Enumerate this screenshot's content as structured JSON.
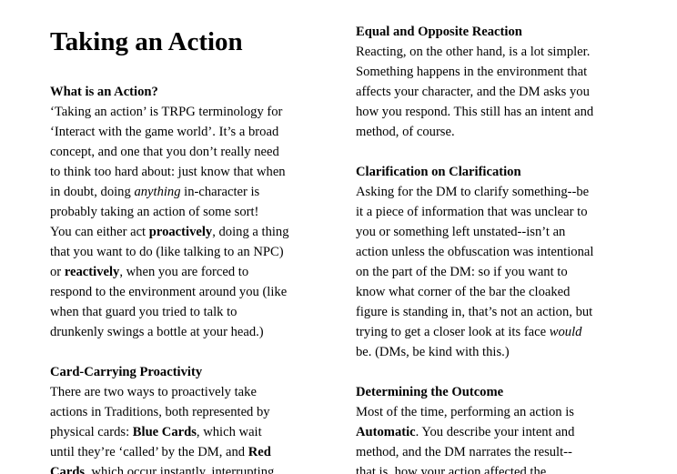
{
  "title": "Taking an Action",
  "left": {
    "s1_heading": "What is an Action?",
    "s1_l1": "‘Taking an action’ is TRPG terminology for",
    "s1_l2": "‘Interact with the game world’. It’s a broad",
    "s1_l3": "concept, and one that you don’t really need",
    "s1_l4": "to think too hard about: just know that when",
    "s1_l5a": "in doubt, doing ",
    "s1_l5b": "anything",
    "s1_l5c": " in-character is",
    "s1_l6": "probably taking an action of some sort!",
    "s1_l7a": "You can either act ",
    "s1_l7b": "proactively",
    "s1_l7c": ", doing a thing",
    "s1_l8": "that you want to do (like talking to an NPC)",
    "s1_l9a": "or ",
    "s1_l9b": "reactively",
    "s1_l9c": ", when you are forced to",
    "s1_l10": "respond to the environment around you (like",
    "s1_l11": "when that guard you tried to talk to",
    "s1_l12": "drunkenly swings a bottle at your head.)",
    "s2_heading": "Card-Carrying Proactivity",
    "s2_l1": "There are two ways to proactively take",
    "s2_l2": "actions in Traditions, both represented by",
    "s2_l3a": "physical cards: ",
    "s2_l3b": "Blue Cards",
    "s2_l3c": ", which wait",
    "s2_l4a": "until they’re ‘called’ by the DM, and ",
    "s2_l4b": "Red",
    "s2_l5a": "Cards",
    "s2_l5b": ", which occur instantly, interrupting"
  },
  "right": {
    "s1_heading": "Equal and Opposite Reaction",
    "s1_l1": "Reacting, on the other hand, is a lot simpler.",
    "s1_l2": "Something happens in the environment that",
    "s1_l3": "affects your character, and the DM asks you",
    "s1_l4": "how you respond. This still has an intent and",
    "s1_l5": "method, of course.",
    "s2_heading": "Clarification on Clarification",
    "s2_l1": "Asking for the DM to clarify something--be",
    "s2_l2": "it a piece of information that was unclear to",
    "s2_l3": "you or something left unstated--isn’t an",
    "s2_l4": "action unless the obfuscation was intentional",
    "s2_l5": "on the part of the DM: so if you want to",
    "s2_l6": "know what corner of the bar the cloaked",
    "s2_l7": "figure is standing in, that’s not an action, but",
    "s2_l8a": "trying to get a closer look at its face ",
    "s2_l8b": "would",
    "s2_l9": "be. (DMs, be kind with this.)",
    "s3_heading": "Determining the Outcome",
    "s3_l1": "Most of the time, performing an action is",
    "s3_l2a": "Automatic",
    "s3_l2b": ". You describe your intent and",
    "s3_l3": "method, and the DM narrates the result--",
    "s3_l4": "that is, how your action affected the"
  }
}
